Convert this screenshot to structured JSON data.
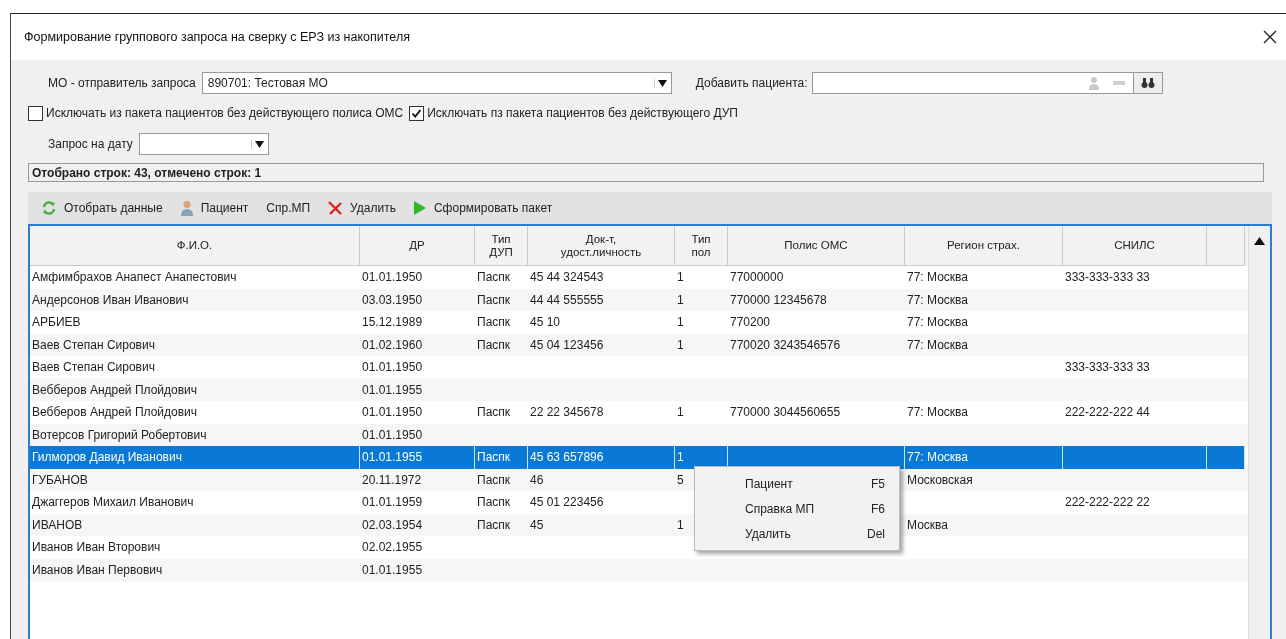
{
  "window": {
    "title": "Формирование группового запроса на сверку с ЕРЗ из накопителя"
  },
  "sender": {
    "label": "МО - отправитель запроса",
    "value": "890701: Тестовая МО"
  },
  "add_patient": {
    "label": "Добавить пациента:"
  },
  "checkboxes": [
    {
      "label": "Исключать из пакета пациентов без действующего полиса ОМС",
      "checked": false
    },
    {
      "label": "Исключать пз пакета пациентов без действующего ДУП",
      "checked": true
    }
  ],
  "date": {
    "label": "Запрос на дату"
  },
  "status": "Отобрано строк: 43, отмечено строк: 1",
  "toolbar": [
    {
      "kind": "refresh",
      "label": "Отобрать данные"
    },
    {
      "kind": "person",
      "label": "Пациент"
    },
    {
      "kind": "plain",
      "label": "Спр.МП"
    },
    {
      "kind": "delete",
      "label": "Удалить"
    },
    {
      "kind": "play",
      "label": "Сформировать пакет"
    }
  ],
  "table": {
    "columns": [
      "Ф.И.О.",
      "ДР",
      "Тип\nДУП",
      "Док-т,\nудост.личность",
      "Тип\nпол",
      "Полис ОМС",
      "Регион страх.",
      "СНИЛС"
    ],
    "rows": [
      {
        "selected": false,
        "cells": [
          "Амфимбрахов Анапест Анапестович",
          "01.01.1950",
          "Паспк",
          "45 44 324543",
          "1",
          "77000000",
          "77: Москва",
          "333-333-333 33"
        ]
      },
      {
        "selected": false,
        "cells": [
          "Андерсонов Иван Иванович",
          "03.03.1950",
          "Паспк",
          "44 44 555555",
          "1",
          "770000 12345678",
          "77: Москва",
          ""
        ]
      },
      {
        "selected": false,
        "cells": [
          "АРБИЕВ",
          "15.12.1989",
          "Паспк",
          "45 10",
          "1",
          "770200",
          "77: Москва",
          ""
        ]
      },
      {
        "selected": false,
        "cells": [
          "Ваев Степан Сирович",
          "01.02.1960",
          "Паспк",
          "45 04 123456",
          "1",
          "770020 3243546576",
          "77: Москва",
          ""
        ]
      },
      {
        "selected": false,
        "cells": [
          "Ваев Степан Сирович",
          "01.01.1950",
          "",
          "",
          "",
          "",
          "",
          "333-333-333 33"
        ]
      },
      {
        "selected": false,
        "cells": [
          "Вебберов Андрей Плойдович",
          "01.01.1955",
          "",
          "",
          "",
          "",
          "",
          ""
        ]
      },
      {
        "selected": false,
        "cells": [
          "Вебберов Андрей Плойдович",
          "01.01.1950",
          "Паспк",
          "22 22 345678",
          "1",
          "770000 3044560655",
          "77: Москва",
          "222-222-222 44"
        ]
      },
      {
        "selected": false,
        "cells": [
          "Вотерсов Григорий Робертович",
          "01.01.1950",
          "",
          "",
          "",
          "",
          "",
          ""
        ]
      },
      {
        "selected": true,
        "cells": [
          "Гилморов Давид Иванович",
          "01.01.1955",
          "Паспк",
          "45 63 657896",
          "1",
          "",
          "77: Москва",
          ""
        ]
      },
      {
        "selected": false,
        "cells": [
          "ГУБАНОВ",
          "20.11.1972",
          "Паспк",
          "46",
          "5",
          "",
          "Московская",
          ""
        ]
      },
      {
        "selected": false,
        "cells": [
          "Джаггеров Михаил Иванович",
          "01.01.1959",
          "Паспк",
          "45 01 223456",
          "",
          "",
          "",
          "222-222-222 22"
        ]
      },
      {
        "selected": false,
        "cells": [
          "ИВАНОВ",
          "02.03.1954",
          "Паспк",
          "45",
          "1",
          "",
          "Москва",
          ""
        ]
      },
      {
        "selected": false,
        "cells": [
          "Иванов Иван Вторович",
          "02.02.1955",
          "",
          "",
          "",
          "",
          "",
          ""
        ]
      },
      {
        "selected": false,
        "cells": [
          "Иванов Иван Первович",
          "01.01.1955",
          "",
          "",
          "",
          "",
          "",
          ""
        ]
      }
    ]
  },
  "context_menu": [
    {
      "label": "Пациент",
      "shortcut": "F5"
    },
    {
      "label": "Справка МП",
      "shortcut": "F6"
    },
    {
      "label": "Удалить",
      "shortcut": "Del"
    }
  ]
}
